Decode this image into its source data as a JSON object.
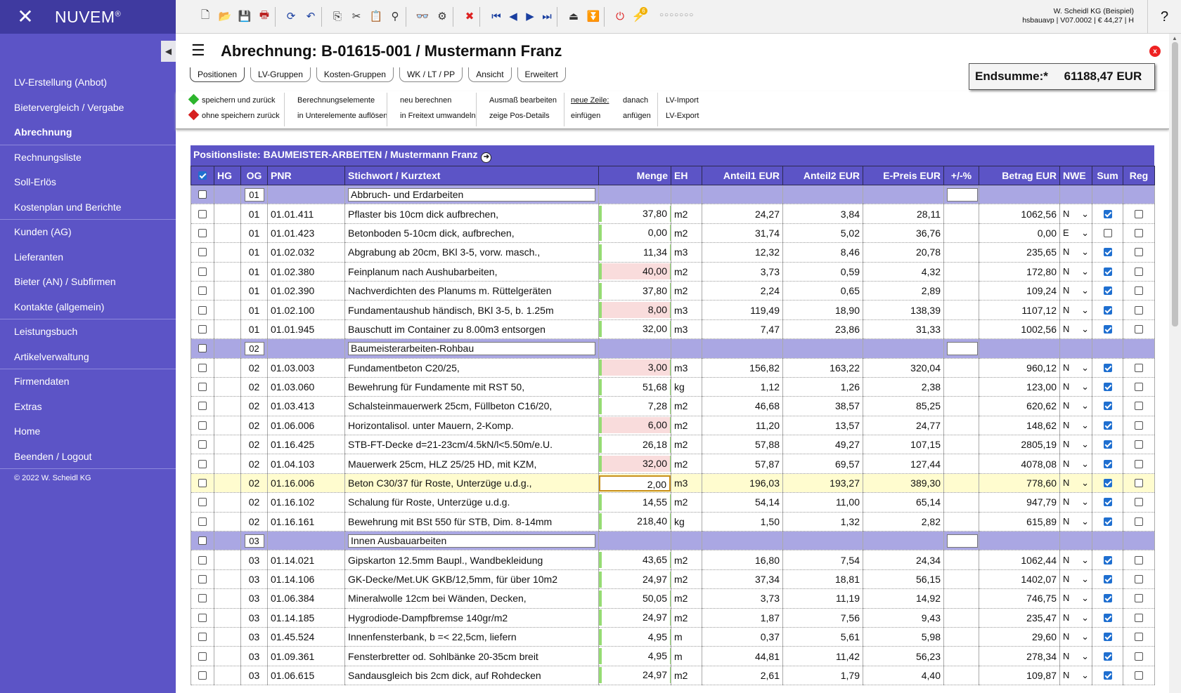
{
  "app": {
    "name": "NUVEM",
    "reg": "®"
  },
  "sidebar": {
    "items": [
      {
        "label": "LV-Erstellung (Anbot)"
      },
      {
        "label": "Bietervergleich / Vergabe"
      },
      {
        "label": "Abrechnung"
      },
      {
        "label": "Rechnungsliste"
      },
      {
        "label": "Soll-Erlös"
      },
      {
        "label": "Kostenplan und Berichte"
      },
      {
        "label": "Kunden (AG)"
      },
      {
        "label": "Lieferanten"
      },
      {
        "label": "Bieter (AN) / Subfirmen"
      },
      {
        "label": "Kontakte (allgemein)"
      },
      {
        "label": "Leistungsbuch"
      },
      {
        "label": "Artikelverwaltung"
      },
      {
        "label": "Firmendaten"
      },
      {
        "label": "Extras"
      },
      {
        "label": "Home"
      },
      {
        "label": "Beenden / Logout"
      }
    ],
    "active": "Abrechnung",
    "copyright": "© 2022 W. Scheidl KG"
  },
  "toolbar": {
    "badge": "6",
    "dots": "○○○○○○○"
  },
  "user": {
    "company": "W. Scheidl KG (Beispiel)",
    "info": "hsbauavp | V07.0002 | € 44,27 | H"
  },
  "help": "?",
  "page": {
    "title": "Abrechnung: B-01615-001 / Mustermann Franz"
  },
  "tabs": [
    "Positionen",
    "LV-Gruppen",
    "Kosten-Gruppen",
    "WK / LT / PP",
    "Ansicht",
    "Erweitert"
  ],
  "endsumme": {
    "label": "Endsumme:*",
    "value": "61188,47 EUR"
  },
  "actions": {
    "save_back": "speichern und zurück",
    "nosave_back": "ohne speichern zurück",
    "calc1": "Berechnungselemente",
    "calc2": "in Unterelemente auflösen",
    "recalc1": "neu berechnen",
    "recalc2": "in Freitext umwandeln",
    "ausmass1": "Ausmaß bearbeiten",
    "ausmass2": "zeige Pos-Details",
    "newline": "neue Zeile:",
    "insert": "einfügen",
    "after1": "danach",
    "after2": "anfügen",
    "import": "LV-Import",
    "export": "LV-Export"
  },
  "list": {
    "title": "Positionsliste: BAUMEISTER-ARBEITEN / Mustermann Franz"
  },
  "columns": [
    "HG",
    "OG",
    "PNR",
    "Stichwort / Kurztext",
    "Menge",
    "EH",
    "Anteil1 EUR",
    "Anteil2 EUR",
    "E-Preis EUR",
    "+/-%",
    "Betrag EUR",
    "NWE",
    "Sum",
    "Reg"
  ],
  "rows": [
    {
      "type": "group",
      "og": "01",
      "text": "Abbruch- und Erdarbeiten"
    },
    {
      "og": "01",
      "pnr": "01.01.411",
      "text": "Pflaster bis 10cm dick aufbrechen,",
      "menge": "37,80",
      "mstate": "green",
      "eh": "m2",
      "a1": "24,27",
      "a2": "3,84",
      "ep": "28,11",
      "betrag": "1062,56",
      "nwe": "N",
      "sum": true,
      "reg": false
    },
    {
      "og": "01",
      "pnr": "01.01.423",
      "text": "Betonboden 5-10cm dick, aufbrechen,",
      "menge": "0,00",
      "mstate": "green",
      "eh": "m2",
      "a1": "31,74",
      "a2": "5,02",
      "ep": "36,76",
      "betrag": "0,00",
      "nwe": "E",
      "sum": false,
      "reg": false
    },
    {
      "og": "01",
      "pnr": "01.02.032",
      "text": "Abgrabung ab 20cm, BKl 3-5, vorw. masch.,",
      "menge": "11,34",
      "mstate": "green",
      "eh": "m3",
      "a1": "12,32",
      "a2": "8,46",
      "ep": "20,78",
      "betrag": "235,65",
      "nwe": "N",
      "sum": true,
      "reg": false
    },
    {
      "og": "01",
      "pnr": "01.02.380",
      "text": "Feinplanum nach Aushubarbeiten,",
      "menge": "40,00",
      "mstate": "pink",
      "eh": "m2",
      "a1": "3,73",
      "a2": "0,59",
      "ep": "4,32",
      "betrag": "172,80",
      "nwe": "N",
      "sum": true,
      "reg": false
    },
    {
      "og": "01",
      "pnr": "01.02.390",
      "text": "Nachverdichten des Planums m. Rüttelgeräten",
      "menge": "37,80",
      "mstate": "green",
      "eh": "m2",
      "a1": "2,24",
      "a2": "0,65",
      "ep": "2,89",
      "betrag": "109,24",
      "nwe": "N",
      "sum": true,
      "reg": false
    },
    {
      "og": "01",
      "pnr": "01.02.100",
      "text": "Fundamentaushub händisch, BKl 3-5, b. 1.25m",
      "menge": "8,00",
      "mstate": "pink",
      "eh": "m3",
      "a1": "119,49",
      "a2": "18,90",
      "ep": "138,39",
      "betrag": "1107,12",
      "nwe": "N",
      "sum": true,
      "reg": false
    },
    {
      "og": "01",
      "pnr": "01.01.945",
      "text": "Bauschutt im Container zu 8.00m3 entsorgen",
      "menge": "32,00",
      "mstate": "green",
      "eh": "m3",
      "a1": "7,47",
      "a2": "23,86",
      "ep": "31,33",
      "betrag": "1002,56",
      "nwe": "N",
      "sum": true,
      "reg": false
    },
    {
      "type": "group",
      "og": "02",
      "text": "Baumeisterarbeiten-Rohbau"
    },
    {
      "og": "02",
      "pnr": "01.03.003",
      "text": "Fundamentbeton C20/25,",
      "menge": "3,00",
      "mstate": "pink",
      "eh": "m3",
      "a1": "156,82",
      "a2": "163,22",
      "ep": "320,04",
      "betrag": "960,12",
      "nwe": "N",
      "sum": true,
      "reg": false
    },
    {
      "og": "02",
      "pnr": "01.03.060",
      "text": "Bewehrung für Fundamente mit RST 50,",
      "menge": "51,68",
      "mstate": "green",
      "eh": "kg",
      "a1": "1,12",
      "a2": "1,26",
      "ep": "2,38",
      "betrag": "123,00",
      "nwe": "N",
      "sum": true,
      "reg": false
    },
    {
      "og": "02",
      "pnr": "01.03.413",
      "text": "Schalsteinmauerwerk 25cm, Füllbeton C16/20,",
      "menge": "7,28",
      "mstate": "green",
      "eh": "m2",
      "a1": "46,68",
      "a2": "38,57",
      "ep": "85,25",
      "betrag": "620,62",
      "nwe": "N",
      "sum": true,
      "reg": false
    },
    {
      "og": "02",
      "pnr": "01.06.006",
      "text": "Horizontalisol. unter Mauern, 2-Komp.",
      "menge": "6,00",
      "mstate": "pink",
      "eh": "m2",
      "a1": "11,20",
      "a2": "13,57",
      "ep": "24,77",
      "betrag": "148,62",
      "nwe": "N",
      "sum": true,
      "reg": false
    },
    {
      "og": "02",
      "pnr": "01.16.425",
      "text": "STB-FT-Decke d=21-23cm/4.5kN/l<5.50m/e.U.",
      "menge": "26,18",
      "mstate": "green",
      "eh": "m2",
      "a1": "57,88",
      "a2": "49,27",
      "ep": "107,15",
      "betrag": "2805,19",
      "nwe": "N",
      "sum": true,
      "reg": false
    },
    {
      "og": "02",
      "pnr": "01.04.103",
      "text": "Mauerwerk 25cm, HLZ 25/25 HD, mit KZM,",
      "menge": "32,00",
      "mstate": "pink",
      "eh": "m2",
      "a1": "57,87",
      "a2": "69,57",
      "ep": "127,44",
      "betrag": "4078,08",
      "nwe": "N",
      "sum": true,
      "reg": false
    },
    {
      "og": "02",
      "pnr": "01.16.006",
      "text": "Beton C30/37 für Roste, Unterzüge u.d.g.,",
      "menge": "2,00",
      "mstate": "sel",
      "eh": "m3",
      "a1": "196,03",
      "a2": "193,27",
      "ep": "389,30",
      "betrag": "778,60",
      "nwe": "N",
      "sum": true,
      "reg": false,
      "hl": true
    },
    {
      "og": "02",
      "pnr": "01.16.102",
      "text": "Schalung für Roste, Unterzüge u.d.g.",
      "menge": "14,55",
      "mstate": "green",
      "eh": "m2",
      "a1": "54,14",
      "a2": "11,00",
      "ep": "65,14",
      "betrag": "947,79",
      "nwe": "N",
      "sum": true,
      "reg": false
    },
    {
      "og": "02",
      "pnr": "01.16.161",
      "text": "Bewehrung mit BSt 550 für STB, Dim. 8-14mm",
      "menge": "218,40",
      "mstate": "green",
      "eh": "kg",
      "a1": "1,50",
      "a2": "1,32",
      "ep": "2,82",
      "betrag": "615,89",
      "nwe": "N",
      "sum": true,
      "reg": false
    },
    {
      "type": "group",
      "og": "03",
      "text": "Innen Ausbauarbeiten"
    },
    {
      "og": "03",
      "pnr": "01.14.021",
      "text": "Gipskarton 12.5mm Baupl., Wandbekleidung",
      "menge": "43,65",
      "mstate": "green",
      "eh": "m2",
      "a1": "16,80",
      "a2": "7,54",
      "ep": "24,34",
      "betrag": "1062,44",
      "nwe": "N",
      "sum": true,
      "reg": false
    },
    {
      "og": "03",
      "pnr": "01.14.106",
      "text": "GK-Decke/Met.UK GKB/12,5mm, für über 10m2",
      "menge": "24,97",
      "mstate": "green",
      "eh": "m2",
      "a1": "37,34",
      "a2": "18,81",
      "ep": "56,15",
      "betrag": "1402,07",
      "nwe": "N",
      "sum": true,
      "reg": false
    },
    {
      "og": "03",
      "pnr": "01.06.384",
      "text": "Mineralwolle 12cm bei Wänden, Decken,",
      "menge": "50,05",
      "mstate": "green",
      "eh": "m2",
      "a1": "3,73",
      "a2": "11,19",
      "ep": "14,92",
      "betrag": "746,75",
      "nwe": "N",
      "sum": true,
      "reg": false
    },
    {
      "og": "03",
      "pnr": "01.14.185",
      "text": "Hygrodiode-Dampfbremse 140gr/m2",
      "menge": "24,97",
      "mstate": "green",
      "eh": "m2",
      "a1": "1,87",
      "a2": "7,56",
      "ep": "9,43",
      "betrag": "235,47",
      "nwe": "N",
      "sum": true,
      "reg": false
    },
    {
      "og": "03",
      "pnr": "01.45.524",
      "text": "Innenfensterbank, b =< 22,5cm, liefern",
      "menge": "4,95",
      "mstate": "green",
      "eh": "m",
      "a1": "0,37",
      "a2": "5,61",
      "ep": "5,98",
      "betrag": "29,60",
      "nwe": "N",
      "sum": true,
      "reg": false
    },
    {
      "og": "03",
      "pnr": "01.09.361",
      "text": "Fensterbretter od. Sohlbänke 20-35cm breit",
      "menge": "4,95",
      "mstate": "green",
      "eh": "m",
      "a1": "44,81",
      "a2": "11,42",
      "ep": "56,23",
      "betrag": "278,34",
      "nwe": "N",
      "sum": true,
      "reg": false
    },
    {
      "og": "03",
      "pnr": "01.06.615",
      "text": "Sandausgleich bis 2cm dick, auf Rohdecken",
      "menge": "24,97",
      "mstate": "green",
      "eh": "m2",
      "a1": "2,61",
      "a2": "1,79",
      "ep": "4,40",
      "betrag": "109,87",
      "nwe": "N",
      "sum": true,
      "reg": false
    }
  ]
}
